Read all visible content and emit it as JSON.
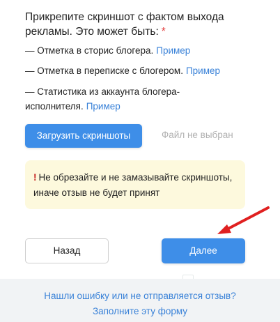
{
  "form": {
    "title": "Прикрепите скриншот с фактом выхода рекламы. Это может быть:",
    "required_mark": "*",
    "items": [
      {
        "text": "— Отметка в сторис блогера.",
        "link": "Пример"
      },
      {
        "text": "— Отметка в переписке с блогером.",
        "link": "Пример"
      },
      {
        "text": "— Статистика из аккаунта блогера-исполнителя.",
        "link": "Пример"
      }
    ],
    "upload_label": "Загрузить скриншоты",
    "no_file_text": "Файл не выбран",
    "warning_icon": "!",
    "warning_text": "Не обрезайте и не замазывайте скриншоты, иначе отзыв не будет принят"
  },
  "actions": {
    "back_label": "Назад",
    "next_label": "Далее"
  },
  "footer": {
    "line1": "Нашли ошибку или не отправляется отзыв?",
    "line2": "Заполните эту форму"
  },
  "colors": {
    "primary": "#3e8ee8",
    "link": "#3a82d8",
    "warning_bg": "#fdf9dd",
    "required": "#e23a3a",
    "annotation_arrow": "#e02020"
  },
  "icons": {
    "warning": "exclamation-icon",
    "annotation": "red-arrow-icon"
  }
}
